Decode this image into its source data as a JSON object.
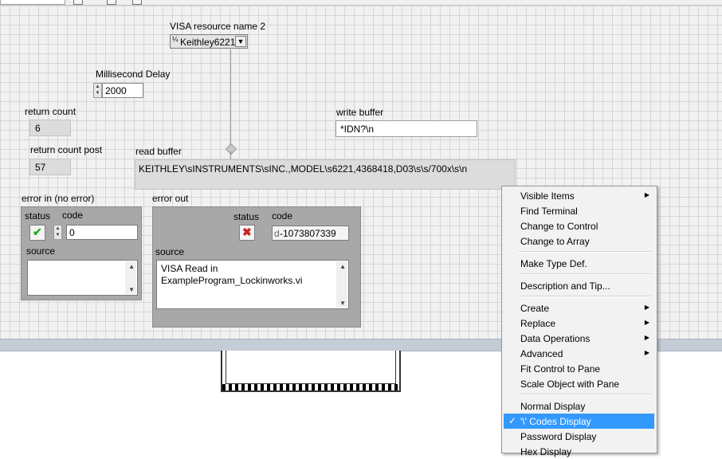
{
  "front_panel": {
    "visa": {
      "label": "VISA resource name 2",
      "icon": "visa-resource-icon",
      "value": "Keithley6221",
      "dropdown_glyph": "▼"
    },
    "delay": {
      "label": "Millisecond Delay",
      "value": "2000"
    },
    "return_count": {
      "label": "return count",
      "value": "6"
    },
    "return_count_post": {
      "label": "return count post",
      "value": "57"
    },
    "write_buffer": {
      "label": "write buffer",
      "value": "*IDN?\\n"
    },
    "read_buffer": {
      "label": "read buffer",
      "value": "KEITHLEY\\sINSTRUMENTS\\sINC.,MODEL\\s6221,4368418,D03\\s\\s/700x\\s\\n"
    },
    "error_in": {
      "label": "error in (no error)",
      "status_label": "status",
      "code_label": "code",
      "source_label": "source",
      "status_glyph": "✔",
      "status_color": "#22aa22",
      "code": "0",
      "source": ""
    },
    "error_out": {
      "label": "error out",
      "status_label": "status",
      "code_label": "code",
      "source_label": "source",
      "status_glyph": "✖",
      "status_color": "#cc2222",
      "code": "-1073807339",
      "source": "VISA Read in\nExampleProgram_Lockinworks.vi"
    }
  },
  "context_menu": {
    "items": [
      {
        "label": "Visible Items",
        "submenu": true
      },
      {
        "label": "Find Terminal"
      },
      {
        "label": "Change to Control"
      },
      {
        "label": "Change to Array"
      },
      {
        "label": "Make Type Def."
      },
      {
        "label": "Description and Tip..."
      },
      {
        "label": "Create",
        "submenu": true
      },
      {
        "label": "Replace",
        "submenu": true
      },
      {
        "label": "Data Operations",
        "submenu": true
      },
      {
        "label": "Advanced",
        "submenu": true
      },
      {
        "label": "Fit Control to Pane"
      },
      {
        "label": "Scale Object with Pane"
      },
      {
        "label": "Normal Display"
      },
      {
        "label": "'\\' Codes Display",
        "checked": true,
        "highlighted": true
      },
      {
        "label": "Password Display"
      },
      {
        "label": "Hex Display"
      }
    ],
    "submenu_glyph": "▶",
    "check_glyph": "✓"
  }
}
